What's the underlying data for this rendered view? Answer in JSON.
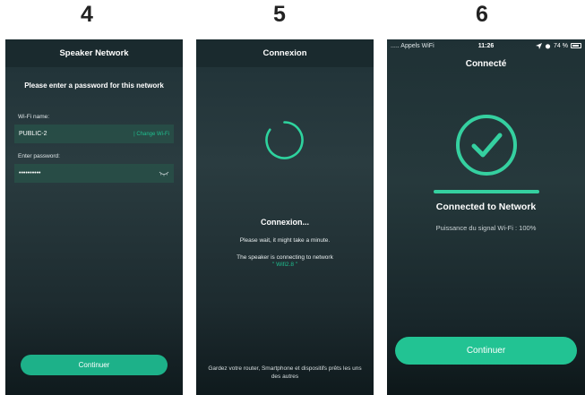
{
  "steps": [
    "4",
    "5",
    "6"
  ],
  "screen1": {
    "title": "Speaker Network",
    "prompt": "Please enter a password for this network",
    "wifi_label": "Wi-Fi name:",
    "wifi_value": "PUBLIC-2",
    "change_wifi": "| Change Wi-Fi",
    "password_label": "Enter password:",
    "password_value": "••••••••••",
    "continue_label": "Continuer"
  },
  "screen2": {
    "title": "Connexion",
    "heading": "Connexion...",
    "wait_text": "Please wait, it might take a minute.",
    "connecting_text": "The speaker is connecting to network",
    "ssid": "\" Wifi2.8 \"",
    "footer_text": "Gardez votre router, Smartphone et dispositifs prêts les uns des autres"
  },
  "screen3": {
    "status": {
      "carrier": "..... Appels WiFi",
      "time": "11:26",
      "battery": "74 %"
    },
    "title": "Connecté",
    "heading": "Connected to Network",
    "signal_text": "Puissance du signal Wi-Fi : 100%",
    "signal_strength": 1.0,
    "continue_label": "Continuer"
  },
  "colors": {
    "accent": "#1db189",
    "accent_bright": "#35d0a0",
    "link": "#1fbf8f",
    "header_bg": "#1a2a2e"
  }
}
